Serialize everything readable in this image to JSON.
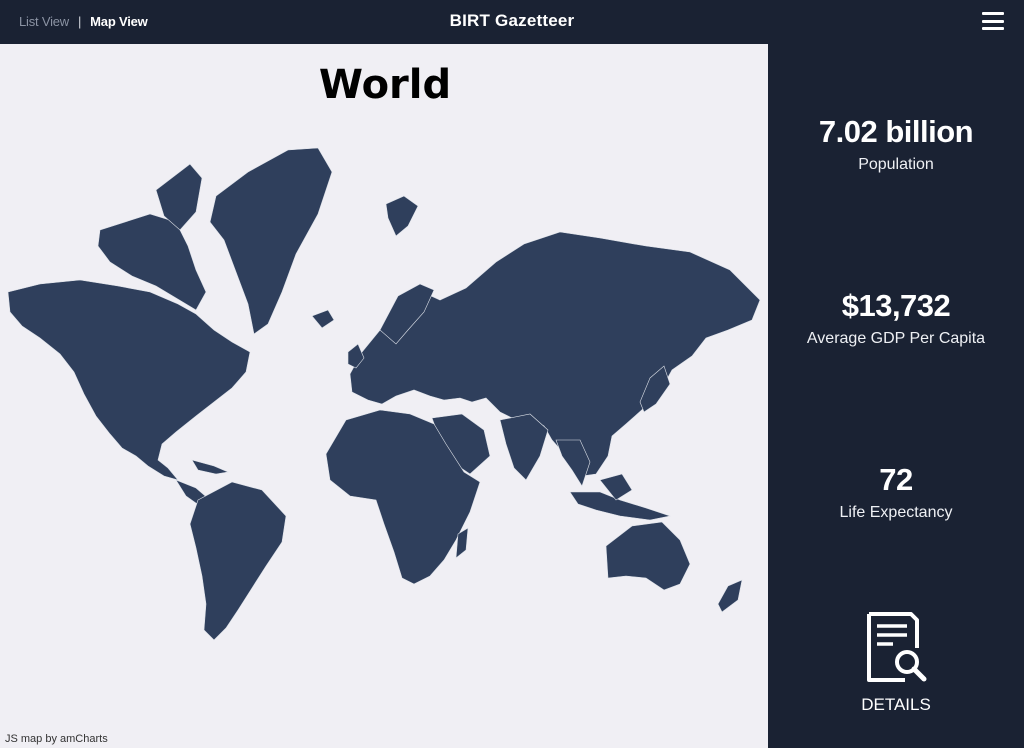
{
  "header": {
    "nav_list": "List View",
    "nav_separator": "|",
    "nav_map": "Map View",
    "title": "BIRT Gazetteer",
    "menu_icon": "hamburger-menu-icon"
  },
  "map": {
    "region_title": "World",
    "credit": "JS map by amCharts",
    "land_color": "#2f3f5c",
    "background_color": "#f0eff4"
  },
  "stats": {
    "population_value": "7.02 billion",
    "population_label": "Population",
    "gdp_value": "$13,732",
    "gdp_label": "Average GDP Per Capita",
    "life_value": "72",
    "life_label": "Life Expectancy"
  },
  "details": {
    "label": "DETAILS",
    "icon": "document-search-icon"
  },
  "colors": {
    "panel": "#1a2233",
    "accent_text": "#ffffff"
  }
}
